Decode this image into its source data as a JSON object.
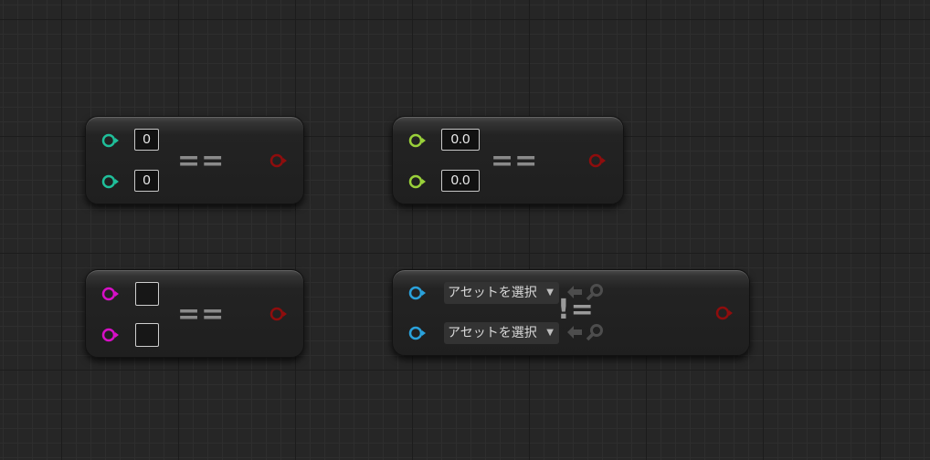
{
  "nodes": [
    {
      "id": "int-equal",
      "operator": "==",
      "input_a": "0",
      "input_b": "0",
      "pin_color": "#1fbf9a",
      "out_color": "#8f0d0d"
    },
    {
      "id": "float-equal",
      "operator": "==",
      "input_a": "0.0",
      "input_b": "0.0",
      "pin_color": "#9ad13a",
      "out_color": "#8f0d0d"
    },
    {
      "id": "bool-equal",
      "operator": "==",
      "pin_color": "#d80fc7",
      "out_color": "#8f0d0d"
    },
    {
      "id": "asset-not-equal",
      "operator": "!=",
      "input_a": "アセットを選択",
      "input_b": "アセットを選択",
      "pin_color": "#2aa2dc",
      "out_color": "#8f0d0d"
    }
  ],
  "icons": {
    "dropdown": "caret-down-icon",
    "use_selected": "arrow-left-icon",
    "browse": "search-icon"
  }
}
